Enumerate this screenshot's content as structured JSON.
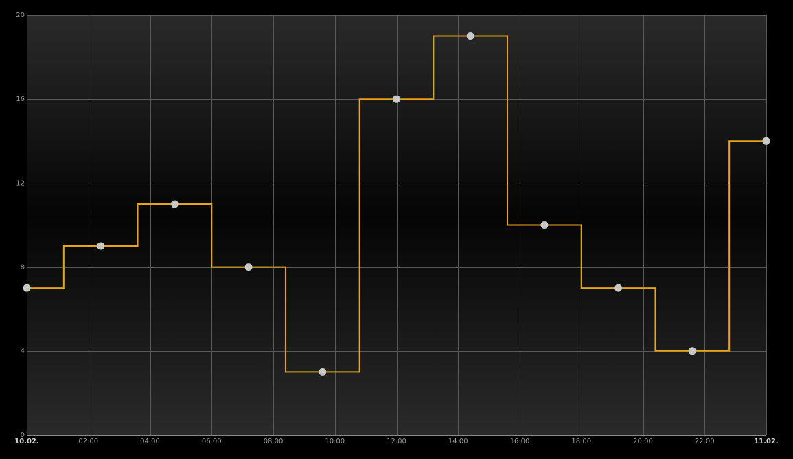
{
  "chart_data": {
    "type": "line",
    "step": "center",
    "x_start": "10.02. 00:00",
    "x_end": "11.02. 00:00",
    "x_tick_labels": [
      "10.02.",
      "02:00",
      "04:00",
      "06:00",
      "08:00",
      "10:00",
      "12:00",
      "14:00",
      "16:00",
      "18:00",
      "20:00",
      "22:00",
      "11.02."
    ],
    "x_tick_bold": [
      "10.02.",
      "11.02."
    ],
    "y_tick_labels": [
      "0",
      "4",
      "8",
      "12",
      "16",
      "20"
    ],
    "ylim": [
      0,
      20
    ],
    "grid": true,
    "series": [
      {
        "color": "#e8a317",
        "marker_color": "#c8c8c8",
        "points": [
          {
            "x": "10.02. 00:00",
            "y": 7
          },
          {
            "x": "10.02. 02:24",
            "y": 9
          },
          {
            "x": "10.02. 04:48",
            "y": 11
          },
          {
            "x": "10.02. 07:12",
            "y": 8
          },
          {
            "x": "10.02. 09:36",
            "y": 3
          },
          {
            "x": "10.02. 12:00",
            "y": 16
          },
          {
            "x": "10.02. 14:24",
            "y": 19
          },
          {
            "x": "10.02. 16:48",
            "y": 10
          },
          {
            "x": "10.02. 19:12",
            "y": 7
          },
          {
            "x": "10.02. 21:36",
            "y": 4
          },
          {
            "x": "11.02. 00:00",
            "y": 14
          }
        ]
      }
    ],
    "colors": {
      "background_edge": "#2a2a2a",
      "background_center": "#050505",
      "grid": "#5a5a5a",
      "tick_text": "#9a9a9a"
    }
  }
}
